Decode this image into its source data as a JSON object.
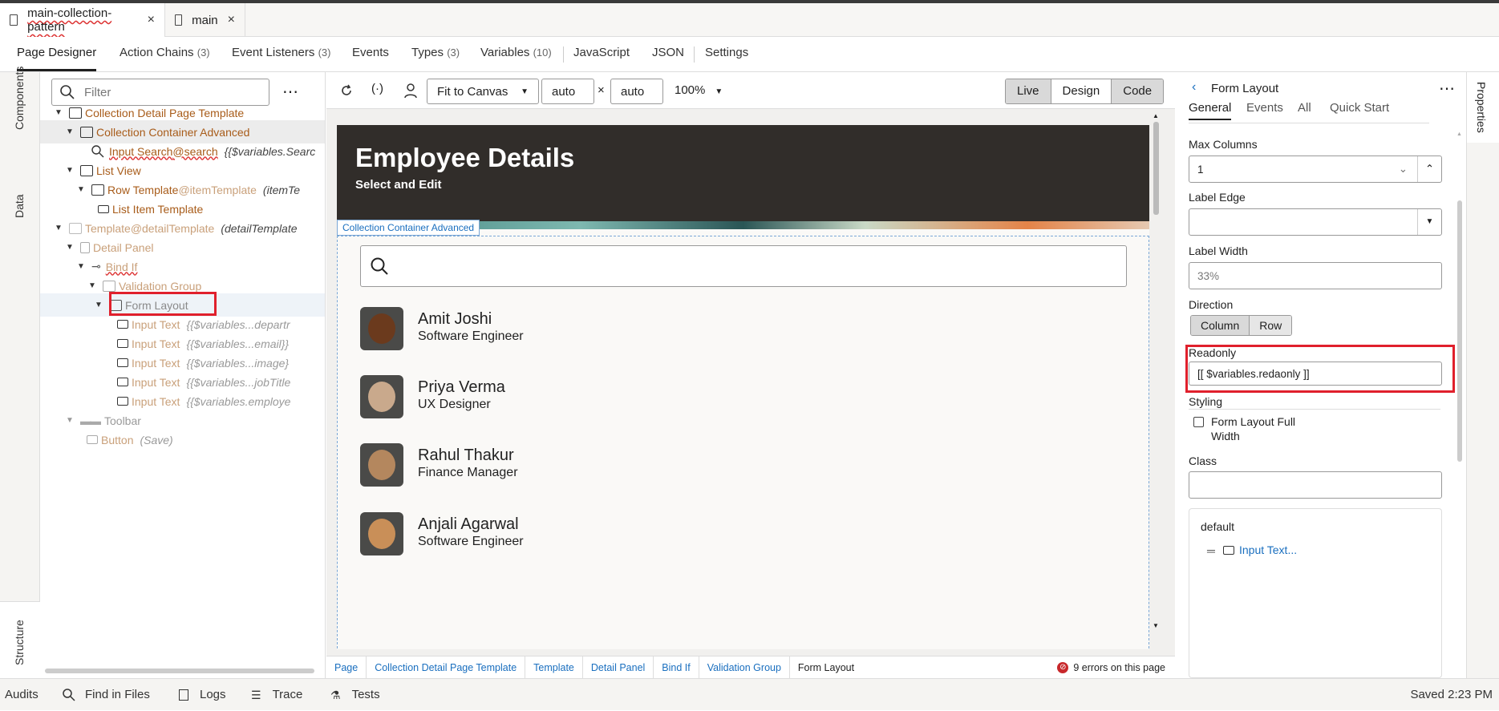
{
  "file_tabs": [
    {
      "label": "main-collection-pattern",
      "active": true
    },
    {
      "label": "main",
      "active": false
    }
  ],
  "nav_tabs": [
    {
      "label": "Page Designer",
      "count": ""
    },
    {
      "label": "Action Chains",
      "count": "(3)"
    },
    {
      "label": "Event Listeners",
      "count": "(3)"
    },
    {
      "label": "Events",
      "count": ""
    },
    {
      "label": "Types",
      "count": "(3)"
    },
    {
      "label": "Variables",
      "count": "(10)"
    },
    {
      "label": "JavaScript",
      "count": ""
    },
    {
      "label": "JSON",
      "count": ""
    },
    {
      "label": "Settings",
      "count": ""
    }
  ],
  "left_rail": {
    "components": "Components",
    "data": "Data",
    "structure": "Structure"
  },
  "structure": {
    "filter_placeholder": "Filter",
    "tree": [
      {
        "label": "Collection Detail Page Template",
        "suffix": "",
        "expr": ""
      },
      {
        "label": "Collection Container Advanced",
        "suffix": "",
        "expr": ""
      },
      {
        "label": "Input Search",
        "suffix": "@search",
        "expr": "{{$variables.Searc"
      },
      {
        "label": "List View",
        "suffix": "",
        "expr": ""
      },
      {
        "label": "Row Template",
        "suffix": "@itemTemplate",
        "expr": "(itemTe"
      },
      {
        "label": "List Item Template",
        "suffix": "",
        "expr": ""
      },
      {
        "label": "Template",
        "suffix": "@detailTemplate",
        "expr": "(detailTemplate"
      },
      {
        "label": "Detail Panel",
        "suffix": "",
        "expr": ""
      },
      {
        "label": "Bind If",
        "suffix": "",
        "expr": ""
      },
      {
        "label": "Validation Group",
        "suffix": "",
        "expr": ""
      },
      {
        "label": "Form Layout",
        "suffix": "",
        "expr": ""
      },
      {
        "label": "Input Text",
        "suffix": "",
        "expr": "{{$variables...departr"
      },
      {
        "label": "Input Text",
        "suffix": "",
        "expr": "{{$variables...email}}"
      },
      {
        "label": "Input Text",
        "suffix": "",
        "expr": "{{$variables...image}"
      },
      {
        "label": "Input Text",
        "suffix": "",
        "expr": "{{$variables...jobTitle"
      },
      {
        "label": "Input Text",
        "suffix": "",
        "expr": "{{$variables.employe"
      },
      {
        "label": "Toolbar",
        "suffix": "",
        "expr": ""
      },
      {
        "label": "Button",
        "suffix": "",
        "expr": "(Save)"
      }
    ]
  },
  "canvas_toolbar": {
    "fit": "Fit to Canvas",
    "width": "auto",
    "height": "auto",
    "times": "×",
    "zoom": "100%",
    "modes": [
      "Live",
      "Design",
      "Code"
    ]
  },
  "preview": {
    "title": "Employee Details",
    "subtitle": "Select and Edit",
    "container_label": "Collection Container Advanced",
    "employees": [
      {
        "name": "Amit Joshi",
        "role": "Software Engineer"
      },
      {
        "name": "Priya Verma",
        "role": "UX Designer"
      },
      {
        "name": "Rahul Thakur",
        "role": "Finance Manager"
      },
      {
        "name": "Anjali Agarwal",
        "role": "Software Engineer"
      }
    ]
  },
  "breadcrumbs": [
    "Page",
    "Collection Detail Page Template",
    "Template",
    "Detail Panel",
    "Bind If",
    "Validation Group",
    "Form Layout"
  ],
  "errors": "9 errors on this page",
  "properties": {
    "title": "Form Layout",
    "tabs": [
      "General",
      "Events",
      "All",
      "Quick Start"
    ],
    "max_columns_label": "Max Columns",
    "max_columns_value": "1",
    "label_edge_label": "Label Edge",
    "label_edge_value": "",
    "label_width_label": "Label Width",
    "label_width_placeholder": "33%",
    "direction_label": "Direction",
    "direction_options": [
      "Column",
      "Row"
    ],
    "readonly_label": "Readonly",
    "readonly_value": "[[ $variables.redaonly ]]",
    "styling_label": "Styling",
    "full_width_label_1": "Form Layout Full",
    "full_width_label_2": "Width",
    "class_label": "Class",
    "default_label": "default",
    "default_item": "Input Text..."
  },
  "right_rail": "Properties",
  "statusbar": {
    "items": [
      "Audits",
      "Find in Files",
      "Logs",
      "Trace",
      "Tests"
    ],
    "saved": "Saved 2:23 PM"
  }
}
